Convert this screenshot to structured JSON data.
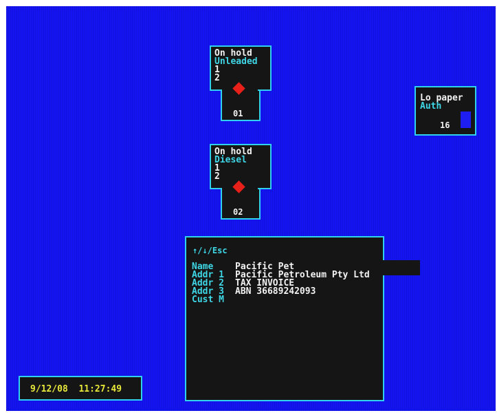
{
  "pumps": [
    {
      "status": "On hold",
      "grade": "Unleaded",
      "hose_1": "1",
      "hose_2": "2",
      "number": "01",
      "nozzle_icon": "red-diamond-icon"
    },
    {
      "status": "On hold",
      "grade": "Diesel",
      "hose_1": "1",
      "hose_2": "2",
      "number": "02",
      "nozzle_icon": "red-diamond-icon"
    }
  ],
  "printer": {
    "status": "Lo paper",
    "mode": "Auth",
    "count": "16"
  },
  "customer_panel": {
    "nav_hint": "↑/↓/Esc",
    "fields": [
      {
        "label": "Name",
        "value": "Pacific Pet"
      },
      {
        "label": "Addr 1",
        "value": "Pacific Petroleum Pty Ltd"
      },
      {
        "label": "Addr 2",
        "value": "TAX INVOICE"
      },
      {
        "label": "Addr 3",
        "value": "ABN 36689242093"
      },
      {
        "label": "Cust M",
        "value": ""
      }
    ]
  },
  "clock": {
    "date": "9/12/08",
    "time": "11:27:49"
  },
  "colors": {
    "background": "#1414f0",
    "panel": "#151515",
    "border": "#2fd1ef",
    "label": "#3fd6e6",
    "text": "#f2f2f2",
    "clock_text": "#e8e83a",
    "nozzle": "#e8201a"
  }
}
